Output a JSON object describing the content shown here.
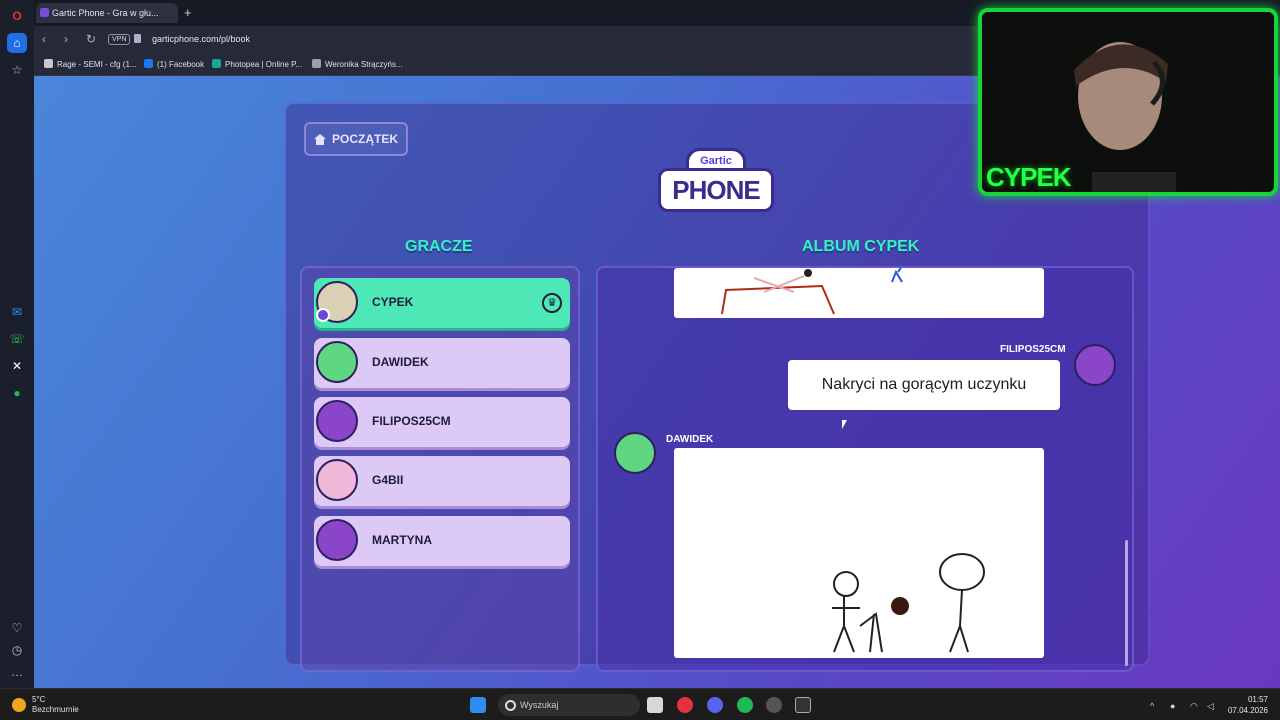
{
  "browser": {
    "tab_title": "Gartic Phone - Gra w głu...",
    "url": "garticphone.com/pl/book",
    "vpn_label": "VPN",
    "bookmarks": [
      {
        "label": "Rage - SEMI - cfg (1...",
        "color": "#c9c9c9"
      },
      {
        "label": "(1) Facebook",
        "color": "#1877f2"
      },
      {
        "label": "Photopea | Online P...",
        "color": "#18a497"
      },
      {
        "label": "Weronika Strączyńs...",
        "color": "#9aa0a6"
      }
    ]
  },
  "game": {
    "home_label": "POCZĄTEK",
    "logo_top": "Gartic",
    "logo_main": "PHONE",
    "players_title": "GRACZE",
    "album_title": "ALBUM CYPEK",
    "players": [
      {
        "name": "CYPEK",
        "active": true,
        "avatar_color": "#d9d0b5"
      },
      {
        "name": "DAWIDEK",
        "active": false,
        "avatar_color": "#5fd680"
      },
      {
        "name": "FILIPOS25CM",
        "active": false,
        "avatar_color": "#8b45c9"
      },
      {
        "name": "G4BII",
        "active": false,
        "avatar_color": "#efb8d8"
      },
      {
        "name": "MARTYNA",
        "active": false,
        "avatar_color": "#8b45c9"
      }
    ],
    "album": {
      "entry1_author": "FILIPOS25CM",
      "entry1_text": "Nakryci na gorącym uczynku",
      "entry2_author": "DAWIDEK"
    }
  },
  "webcam": {
    "name": "CYPEK",
    "accent": "#17d43a"
  },
  "taskbar": {
    "weather_temp": "5°C",
    "weather_desc": "Bezchmurnie",
    "search_placeholder": "Wyszukaj",
    "time": "01:57",
    "date": "07.04.2026"
  }
}
